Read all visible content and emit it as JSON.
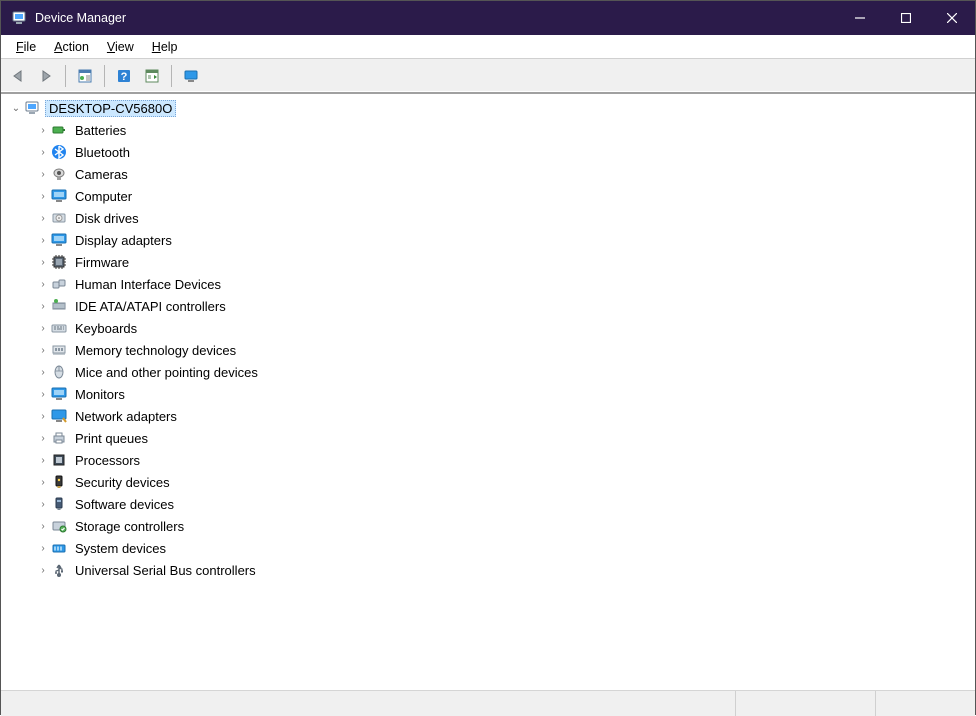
{
  "window": {
    "title": "Device Manager"
  },
  "menu": {
    "file": "File",
    "action": "Action",
    "view": "View",
    "help": "Help"
  },
  "toolbar": {
    "back": "Back",
    "forward": "Forward",
    "properties": "Show properties",
    "help": "Help",
    "scan": "Scan for hardware changes",
    "monitor": "Monitor"
  },
  "tree": {
    "root": "DESKTOP-CV5680O",
    "categories": [
      {
        "label": "Batteries",
        "icon": "battery"
      },
      {
        "label": "Bluetooth",
        "icon": "bluetooth"
      },
      {
        "label": "Cameras",
        "icon": "camera"
      },
      {
        "label": "Computer",
        "icon": "monitor"
      },
      {
        "label": "Disk drives",
        "icon": "disk"
      },
      {
        "label": "Display adapters",
        "icon": "monitor"
      },
      {
        "label": "Firmware",
        "icon": "chip"
      },
      {
        "label": "Human Interface Devices",
        "icon": "hid"
      },
      {
        "label": "IDE ATA/ATAPI controllers",
        "icon": "ide"
      },
      {
        "label": "Keyboards",
        "icon": "keyboard"
      },
      {
        "label": "Memory technology devices",
        "icon": "memory"
      },
      {
        "label": "Mice and other pointing devices",
        "icon": "mouse"
      },
      {
        "label": "Monitors",
        "icon": "monitor"
      },
      {
        "label": "Network adapters",
        "icon": "network"
      },
      {
        "label": "Print queues",
        "icon": "printer"
      },
      {
        "label": "Processors",
        "icon": "cpu"
      },
      {
        "label": "Security devices",
        "icon": "security"
      },
      {
        "label": "Software devices",
        "icon": "software"
      },
      {
        "label": "Storage controllers",
        "icon": "storage"
      },
      {
        "label": "System devices",
        "icon": "system"
      },
      {
        "label": "Universal Serial Bus controllers",
        "icon": "usb"
      }
    ]
  }
}
